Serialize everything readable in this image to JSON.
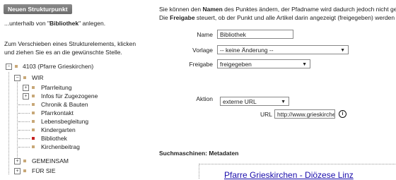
{
  "sidebar": {
    "new_button": "Neuen Strukturpunkt",
    "under_prefix": "...unterhalb von \"",
    "under_name": "Bibliothek",
    "under_suffix": "\" anlegen.",
    "help_text": "Zum Verschieben eines Strukturelements, klicken und ziehen Sie es an die gewünschte Stelle."
  },
  "tree": {
    "root": "4103 (Pfarre Grieskirchen)",
    "wir": "WIR",
    "children": [
      "Pfarrleitung",
      "Infos für Zugezogene",
      "Chronik & Bauten",
      "Pfarrkontakt",
      "Lebensbegleitung",
      "Kindergarten",
      "Bibliothek",
      "Kirchenbeitrag"
    ],
    "gemeinsam": "GEMEINSAM",
    "fuer_sie": "FÜR SIE"
  },
  "form": {
    "intro_1a": "Sie können den ",
    "intro_1b": "Namen",
    "intro_1c": " des Punktes ändern, der Pfadname wird dadurch jedoch nicht geändert",
    "intro_2a": "Die ",
    "intro_2b": "Freigabe",
    "intro_2c": " steuert, ob der Punkt und alle Artikel darin angezeigt (freigegeben) werden oder",
    "name_label": "Name",
    "name_value": "Bibliothek",
    "vorlage_label": "Vorlage",
    "vorlage_value": "-- keine Änderung --",
    "freigabe_label": "Freigabe",
    "freigabe_value": "freigegeben",
    "aktion_label": "Aktion",
    "aktion_value": "externe URL",
    "url_label": "URL",
    "url_value": "http://www.grieskirchen"
  },
  "seo": {
    "title": "Suchmaschinen: Metadaten",
    "preview_link": "Pfarre Grieskirchen - Diözese Linz"
  },
  "icons": {
    "info": "info-icon",
    "expand": "plus-icon",
    "collapse": "minus-icon"
  },
  "colors": {
    "accent_red": "#c62020",
    "link_blue": "#1a0dab"
  }
}
